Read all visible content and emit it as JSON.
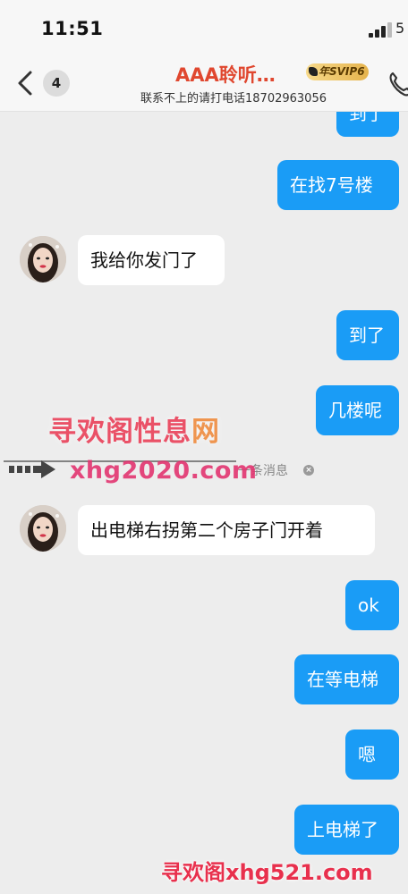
{
  "status_bar": {
    "time": "11:51",
    "extra": "5"
  },
  "header": {
    "unread_count": "4",
    "title": "AAA聆听…",
    "badge": "年SVIP6",
    "subtitle": "联系不上的请打电话18702963056"
  },
  "messages": [
    {
      "side": "out",
      "text": "到了"
    },
    {
      "side": "out",
      "text": "在找7号楼"
    },
    {
      "side": "in",
      "text": "我给你发门了"
    },
    {
      "side": "out",
      "text": "到了"
    },
    {
      "side": "out",
      "text": "几楼呢"
    },
    {
      "side": "system",
      "text": "一条消息"
    },
    {
      "side": "in",
      "text": "出电梯右拐第二个房子门开着"
    },
    {
      "side": "out",
      "text": "ok"
    },
    {
      "side": "out",
      "text": "在等电梯"
    },
    {
      "side": "out",
      "text": "嗯"
    },
    {
      "side": "out",
      "text": "上电梯了"
    }
  ],
  "watermarks": {
    "site_name_main": "寻欢阁性息",
    "site_name_tail": "网",
    "site_url": "xhg2020.com",
    "footer": "寻欢阁xhg521.com"
  },
  "colors": {
    "outgoing_bubble": "#1a9cf6",
    "incoming_bubble": "#ffffff",
    "background": "#ededed",
    "title": "#e0472f"
  },
  "icons": [
    "back-chevron-icon",
    "phone-icon",
    "signal-icon",
    "close-icon",
    "arrow-icon"
  ]
}
